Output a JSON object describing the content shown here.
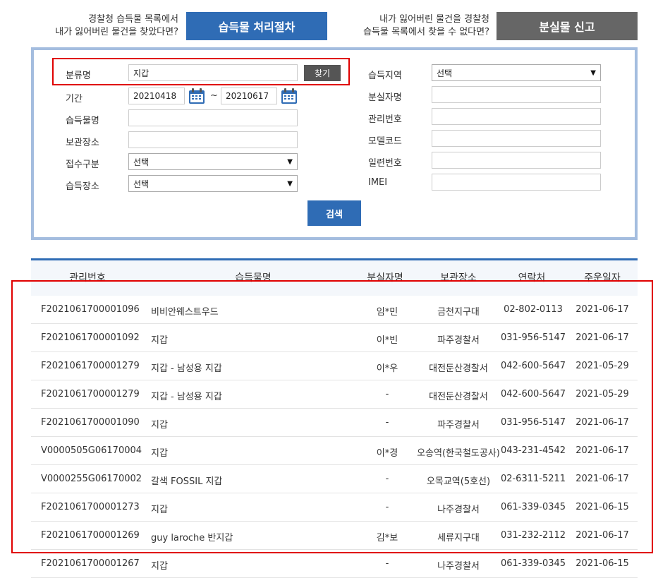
{
  "banner": {
    "left_text_line1": "경찰청 습득물 목록에서",
    "left_text_line2": "내가 잃어버린 물건을 찾았다면?",
    "left_button": "습득물 처리절차",
    "right_text_line1": "내가 잃어버린 물건을 경찰청",
    "right_text_line2": "습득물 목록에서 찾을 수 없다면?",
    "right_button": "분실물 신고"
  },
  "search": {
    "category_label": "분류명",
    "category_value": "지갑",
    "find_button": "찾기",
    "period_label": "기간",
    "date_from": "20210418",
    "date_to": "20210617",
    "tilde": "~",
    "item_name_label": "습득물명",
    "storage_label": "보관장소",
    "reception_label": "접수구분",
    "reception_value": "선택",
    "found_place_label": "습득장소",
    "found_place_value": "선택",
    "region_label": "습득지역",
    "region_value": "선택",
    "loser_label": "분실자명",
    "mgmt_no_label": "관리번호",
    "model_label": "모델코드",
    "serial_label": "일련번호",
    "imei_label": "IMEI",
    "search_button": "검색"
  },
  "table": {
    "headers": [
      "관리번호",
      "습득물명",
      "분실자명",
      "보관장소",
      "연락처",
      "주운일자"
    ],
    "rows": [
      [
        "F2021061700001096",
        "비비안웨스트우드",
        "임*민",
        "금천지구대",
        "02-802-0113",
        "2021-06-17"
      ],
      [
        "F2021061700001092",
        "지갑",
        "이*빈",
        "파주경찰서",
        "031-956-5147",
        "2021-06-17"
      ],
      [
        "F2021061700001279",
        "지갑 - 남성용 지갑",
        "이*우",
        "대전둔산경찰서",
        "042-600-5647",
        "2021-05-29"
      ],
      [
        "F2021061700001279",
        "지갑 - 남성용 지갑",
        "-",
        "대전둔산경찰서",
        "042-600-5647",
        "2021-05-29"
      ],
      [
        "F2021061700001090",
        "지갑",
        "-",
        "파주경찰서",
        "031-956-5147",
        "2021-06-17"
      ],
      [
        "V0000505G06170004",
        "지갑",
        "이*경",
        "오송역(한국철도공사)",
        "043-231-4542",
        "2021-06-17"
      ],
      [
        "V0000255G06170002",
        "갈색 FOSSIL 지갑",
        "-",
        "오목교역(5호선)",
        "02-6311-5211",
        "2021-06-17"
      ],
      [
        "F2021061700001273",
        "지갑",
        "-",
        "나주경찰서",
        "061-339-0345",
        "2021-06-15"
      ],
      [
        "F2021061700001269",
        "guy laroche 반지갑",
        "김*보",
        "세류지구대",
        "031-232-2112",
        "2021-06-17"
      ],
      [
        "F2021061700001267",
        "지갑",
        "-",
        "나주경찰서",
        "061-339-0345",
        "2021-06-15"
      ]
    ]
  },
  "colors": {
    "accent": "#2f6cb5",
    "panel_border": "#a4bddf",
    "highlight": "#e00000"
  }
}
